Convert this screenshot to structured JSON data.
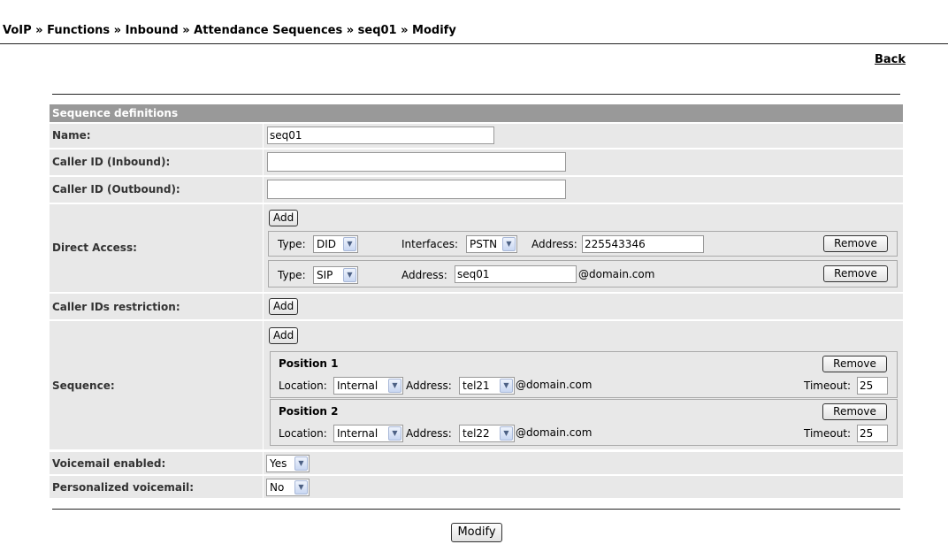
{
  "breadcrumb": "VoIP » Functions » Inbound » Attendance Sequences » seq01 » Modify",
  "back_label": "Back",
  "section_title": "Sequence definitions",
  "name": {
    "label": "Name:",
    "value": "seq01"
  },
  "caller_id_inbound": {
    "label": "Caller ID (Inbound):",
    "value": ""
  },
  "caller_id_outbound": {
    "label": "Caller ID (Outbound):",
    "value": ""
  },
  "direct_access": {
    "label": "Direct Access:",
    "add_label": "Add",
    "entries": [
      {
        "type_label": "Type:",
        "type": "DID",
        "interfaces_label": "Interfaces:",
        "interface": "PSTN",
        "address_label": "Address:",
        "address": "225543346",
        "remove_label": "Remove"
      },
      {
        "type_label": "Type:",
        "type": "SIP",
        "address_label": "Address:",
        "address": "seq01",
        "domain": "@domain.com",
        "remove_label": "Remove"
      }
    ]
  },
  "caller_ids_restriction": {
    "label": "Caller IDs restriction:",
    "add_label": "Add"
  },
  "sequence": {
    "label": "Sequence:",
    "add_label": "Add",
    "positions": [
      {
        "title": "Position 1",
        "remove_label": "Remove",
        "location_label": "Location:",
        "location": "Internal",
        "address_label": "Address:",
        "address": "tel21",
        "domain": "@domain.com",
        "timeout_label": "Timeout:",
        "timeout": "25"
      },
      {
        "title": "Position 2",
        "remove_label": "Remove",
        "location_label": "Location:",
        "location": "Internal",
        "address_label": "Address:",
        "address": "tel22",
        "domain": "@domain.com",
        "timeout_label": "Timeout:",
        "timeout": "25"
      }
    ]
  },
  "voicemail_enabled": {
    "label": "Voicemail enabled:",
    "value": "Yes"
  },
  "personalized_voicemail": {
    "label": "Personalized voicemail:",
    "value": "No"
  },
  "modify_label": "Modify",
  "icons": {
    "dropdown_arrow": "chevron-down-icon"
  }
}
